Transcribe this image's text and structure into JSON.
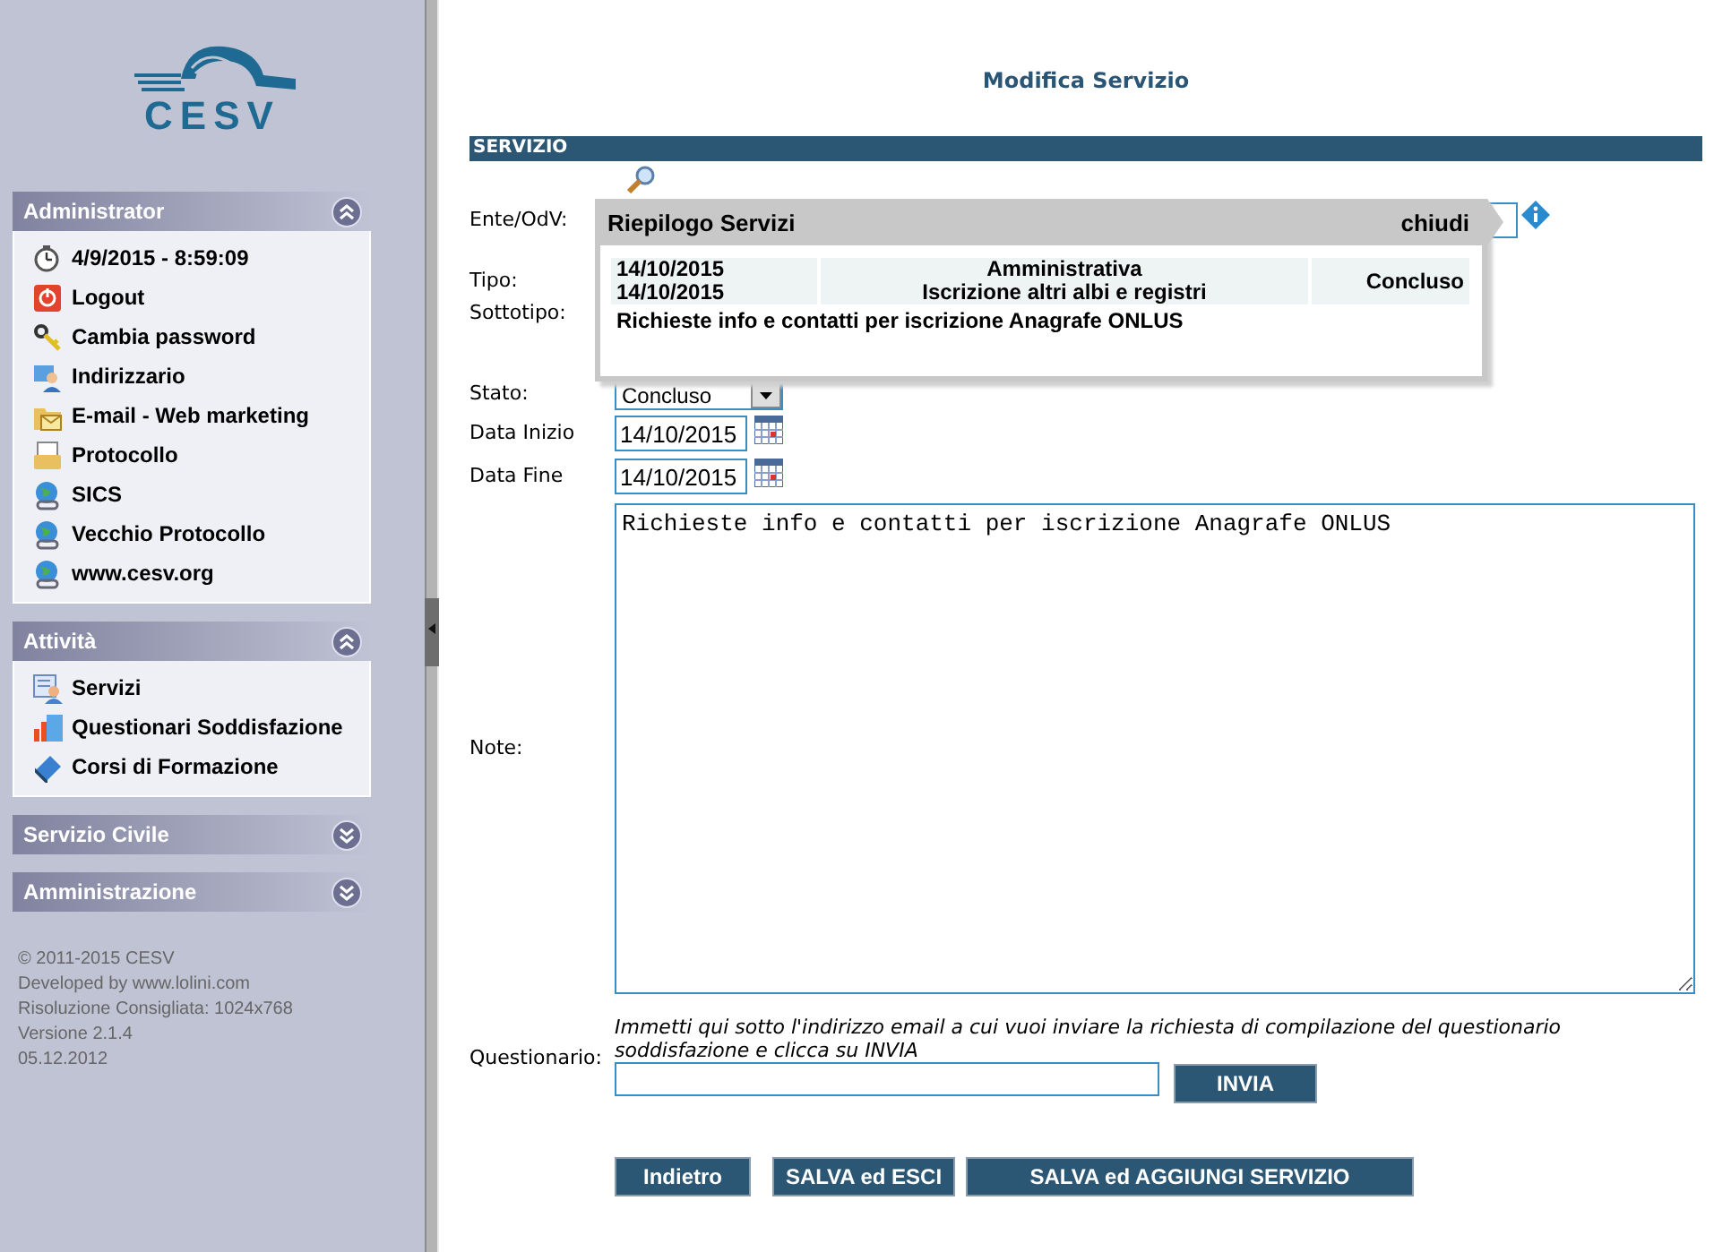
{
  "sidebar": {
    "logo": {
      "text": "CESV"
    },
    "panels": [
      {
        "title": "Administrator",
        "expanded": true,
        "items": [
          {
            "label": "4/9/2015 - 8:59:09"
          },
          {
            "label": "Logout"
          },
          {
            "label": "Cambia password"
          },
          {
            "label": "Indirizzario"
          },
          {
            "label": "E-mail - Web marketing"
          },
          {
            "label": "Protocollo"
          },
          {
            "label": "SICS"
          },
          {
            "label": "Vecchio Protocollo"
          },
          {
            "label": "www.cesv.org"
          }
        ]
      },
      {
        "title": "Attività",
        "expanded": true,
        "items": [
          {
            "label": "Servizi"
          },
          {
            "label": "Questionari Soddisfazione"
          },
          {
            "label": "Corsi di Formazione"
          }
        ]
      },
      {
        "title": "Servizio Civile",
        "expanded": false
      },
      {
        "title": "Amministrazione",
        "expanded": false
      }
    ],
    "footer": [
      "© 2011-2015 CESV",
      "Developed by www.lolini.com",
      "Risoluzione Consigliata: 1024x768",
      "Versione 2.1.4",
      "05.12.2012"
    ]
  },
  "main": {
    "title": "Modifica Servizio",
    "section": "SERVIZIO",
    "labels": {
      "ente": "Ente/OdV:",
      "tipo": "Tipo:",
      "sottotipo": "Sottotipo:",
      "stato": "Stato:",
      "data_inizio": "Data Inizio",
      "data_fine": "Data Fine",
      "note": "Note:",
      "questionario": "Questionario:"
    },
    "stato": "Concluso",
    "data_inizio": "14/10/2015",
    "data_fine": "14/10/2015",
    "note": "Richieste info e contatti per iscrizione Anagrafe ONLUS",
    "questionario_hint": "Immetti qui sotto l'indirizzo email a cui vuoi inviare la richiesta di compilazione del questionario soddisfazione e clicca su INVIA",
    "invia": "INVIA",
    "buttons": [
      "Indietro",
      "SALVA ed ESCI",
      "SALVA ed AGGIUNGI SERVIZIO"
    ],
    "popup": {
      "title": "Riepilogo Servizi",
      "close": "chiudi",
      "row": {
        "date_1": "14/10/2015",
        "date_2": "14/10/2015",
        "tipo": "Amministrativa",
        "sottotipo": "Iscrizione altri albi e registri",
        "stato": "Concluso"
      },
      "note": "Richieste info e contatti per iscrizione Anagrafe ONLUS"
    }
  }
}
